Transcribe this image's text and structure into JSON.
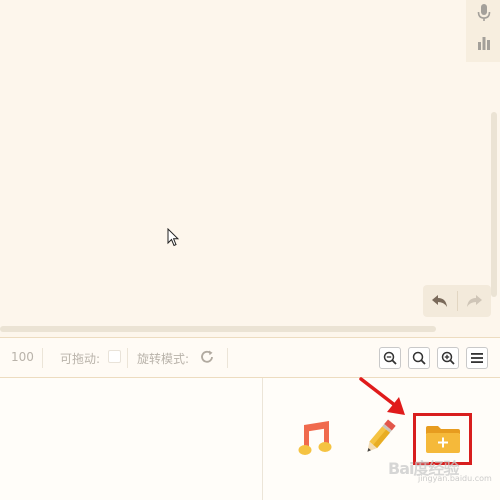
{
  "toolbar": {
    "zoom_value": "100",
    "draggable_label": "可拖动:",
    "rotate_label": "旋转模式:"
  },
  "icons": {
    "mic": "microphone-icon",
    "chart": "bar-chart-icon",
    "undo": "undo-icon",
    "redo": "redo-icon",
    "refresh": "refresh-icon",
    "zoom_out": "zoom-out-icon",
    "zoom_reset": "zoom-reset-icon",
    "zoom_in": "zoom-in-icon",
    "menu": "menu-icon",
    "music": "music-icon",
    "pencil": "pencil-icon",
    "folder_add": "folder-add-icon"
  },
  "watermark": {
    "text": "Bai度经验",
    "sub": "jingyan.baidu.com"
  },
  "colors": {
    "canvas_bg": "#fdf6ec",
    "highlight_border": "#d81e1e",
    "arrow": "#e01b1b",
    "folder": "#f5b93a",
    "music": "#f06a4d"
  }
}
